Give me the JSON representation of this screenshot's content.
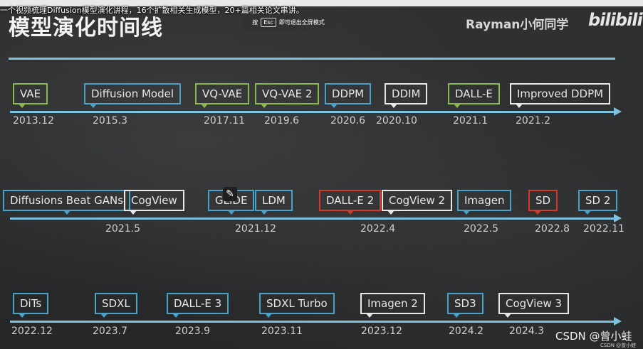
{
  "header": {
    "caption": "一个视频梳理Diffusion模型演化讲程，16个扩散相关生成模型，20+篇相关论文串讲。",
    "title": "模型演化时间线",
    "esc_toast": {
      "prefix": "按",
      "key": "Esc",
      "suffix": "即可退出全屏模式"
    },
    "author": "Rayman小何同学",
    "logo": "bilibili"
  },
  "timeline": {
    "row1": [
      {
        "label": "VAE",
        "date": "2013.12",
        "color": "green"
      },
      {
        "label": "Diffusion Model",
        "date": "2015.3",
        "color": "blue"
      },
      {
        "label": "VQ-VAE",
        "date": "2017.11",
        "color": "green"
      },
      {
        "label": "VQ-VAE 2",
        "date": "2019.6",
        "color": "green"
      },
      {
        "label": "DDPM",
        "date": "2020.6",
        "color": "blue"
      },
      {
        "label": "DDIM",
        "date": "2020.10",
        "color": "white"
      },
      {
        "label": "DALL-E",
        "date": "2021.1",
        "color": "green"
      },
      {
        "label": "Improved DDPM",
        "date": "2021.2",
        "color": "white"
      }
    ],
    "row2": [
      {
        "label": "Diffusions Beat GANs",
        "date": "",
        "color": "blue"
      },
      {
        "label": "CogView",
        "date": "2021.5",
        "color": "white"
      },
      {
        "label": "GLIDE",
        "date": "",
        "color": "blue"
      },
      {
        "label": "LDM",
        "date": "2021.12",
        "color": "blue"
      },
      {
        "label": "DALL-E 2",
        "date": "",
        "color": "red"
      },
      {
        "label": "CogView 2",
        "date": "2022.4",
        "color": "white"
      },
      {
        "label": "Imagen",
        "date": "2022.5",
        "color": "blue"
      },
      {
        "label": "SD",
        "date": "2022.8",
        "color": "red"
      },
      {
        "label": "SD 2",
        "date": "2022.11",
        "color": "blue"
      }
    ],
    "row3": [
      {
        "label": "DiTs",
        "date": "2022.12",
        "color": "blue"
      },
      {
        "label": "SDXL",
        "date": "2023.7",
        "color": "blue"
      },
      {
        "label": "DALL-E 3",
        "date": "2023.9",
        "color": "blue"
      },
      {
        "label": "SDXL Turbo",
        "date": "2023.11",
        "color": "blue"
      },
      {
        "label": "Imagen 2",
        "date": "2023.12",
        "color": "white"
      },
      {
        "label": "SD3",
        "date": "2024.2",
        "color": "blue"
      },
      {
        "label": "CogView 3",
        "date": "2024.3",
        "color": "white"
      }
    ]
  },
  "footer": {
    "csdn": "CSDN @曾小蛙",
    "csdn_small": "CSDN @曾小蛙"
  }
}
